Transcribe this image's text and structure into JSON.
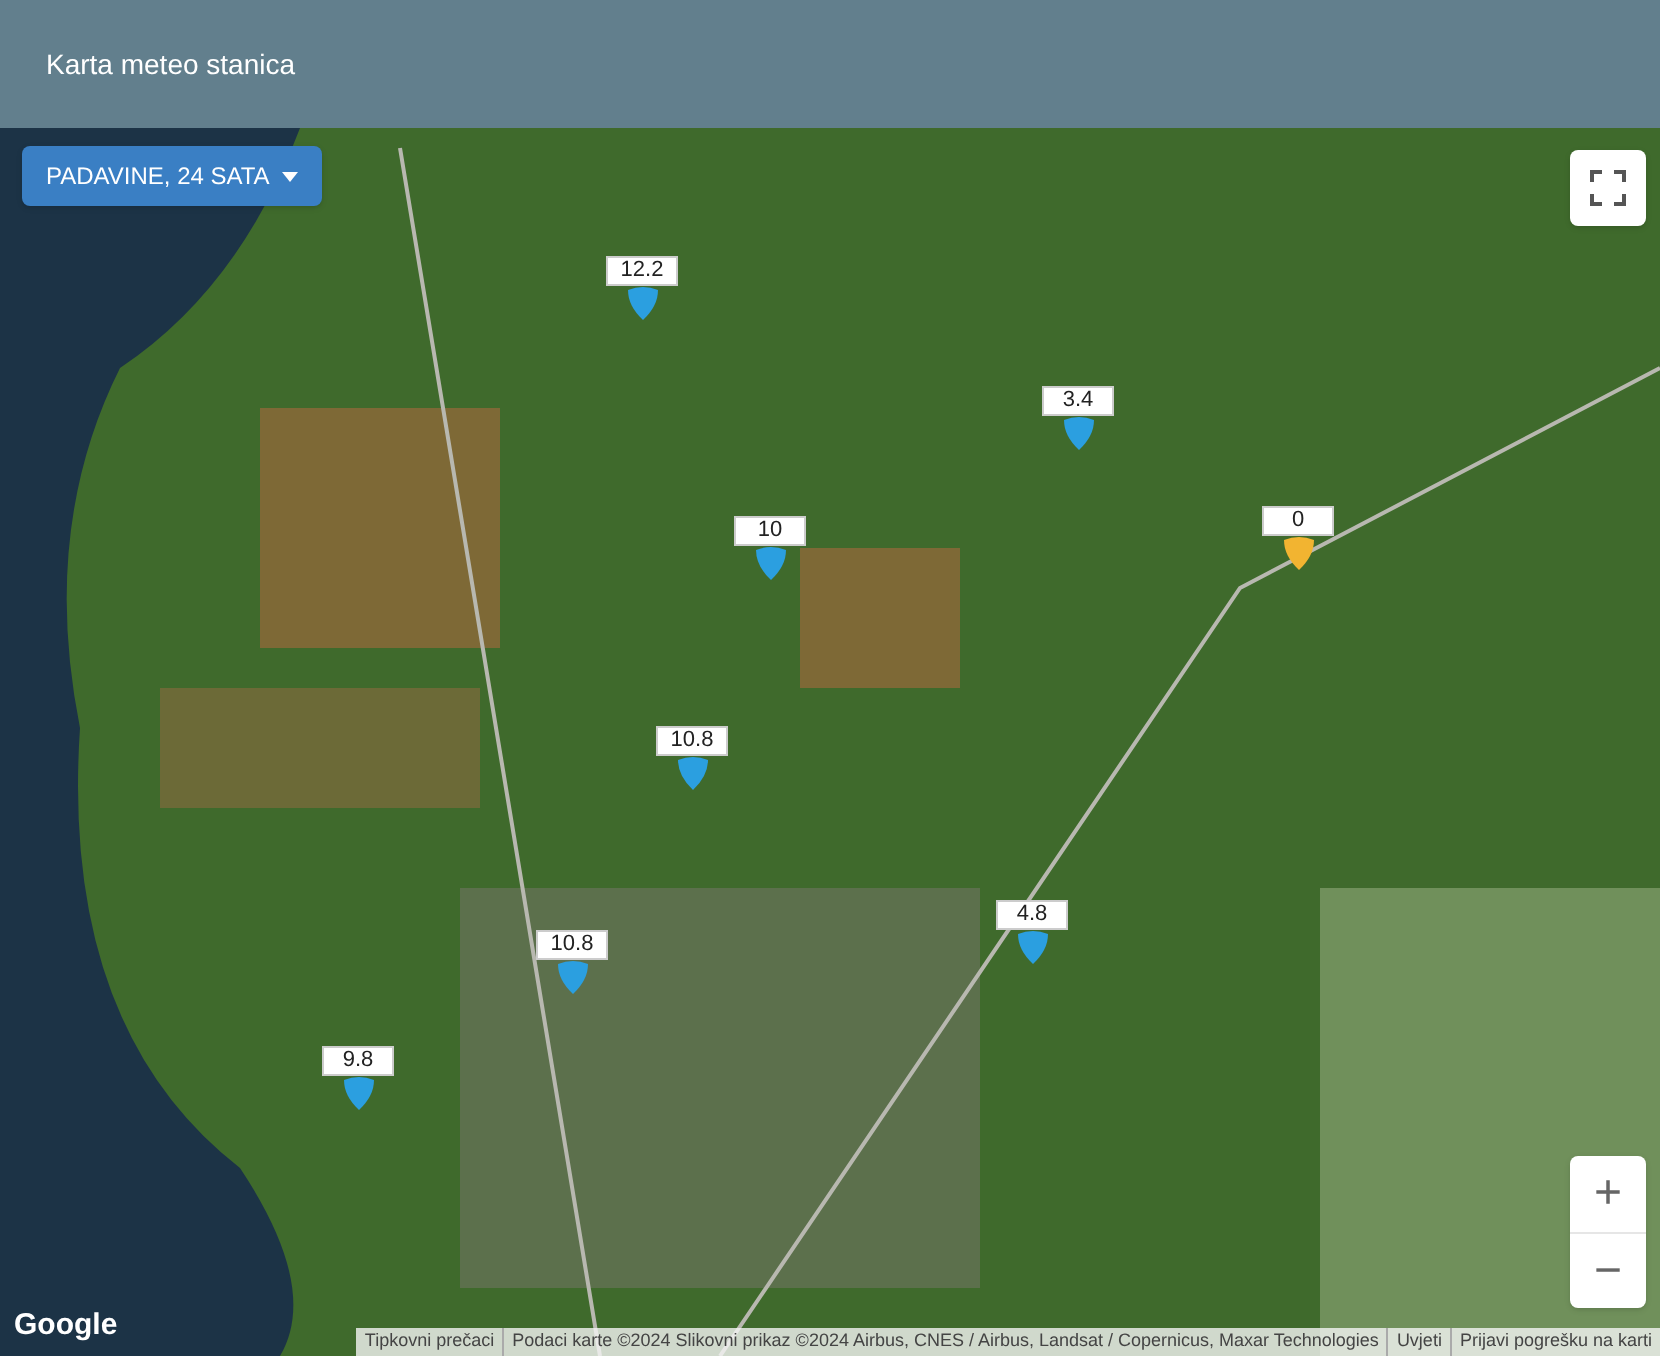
{
  "header": {
    "title": "Karta meteo stanica"
  },
  "map": {
    "layer_button": {
      "label": "PADAVINE, 24 SATA"
    },
    "stations": [
      {
        "value": "12.2",
        "color": "#2b9fe0"
      },
      {
        "value": "3.4",
        "color": "#2b9fe0"
      },
      {
        "value": "10",
        "color": "#2b9fe0"
      },
      {
        "value": "0",
        "color": "#f2b431"
      },
      {
        "value": "10.8",
        "color": "#2b9fe0"
      },
      {
        "value": "4.8",
        "color": "#2b9fe0"
      },
      {
        "value": "10.8",
        "color": "#2b9fe0"
      },
      {
        "value": "9.8",
        "color": "#2b9fe0"
      }
    ],
    "logo": "Google",
    "zoom_in": "+",
    "zoom_out": "−",
    "attribution": [
      "Tipkovni prečaci",
      "Podaci karte ©2024 Slikovni prikaz ©2024 Airbus, CNES / Airbus, Landsat / Copernicus, Maxar Technologies",
      "Uvjeti",
      "Prijavi pogrešku na karti"
    ]
  }
}
